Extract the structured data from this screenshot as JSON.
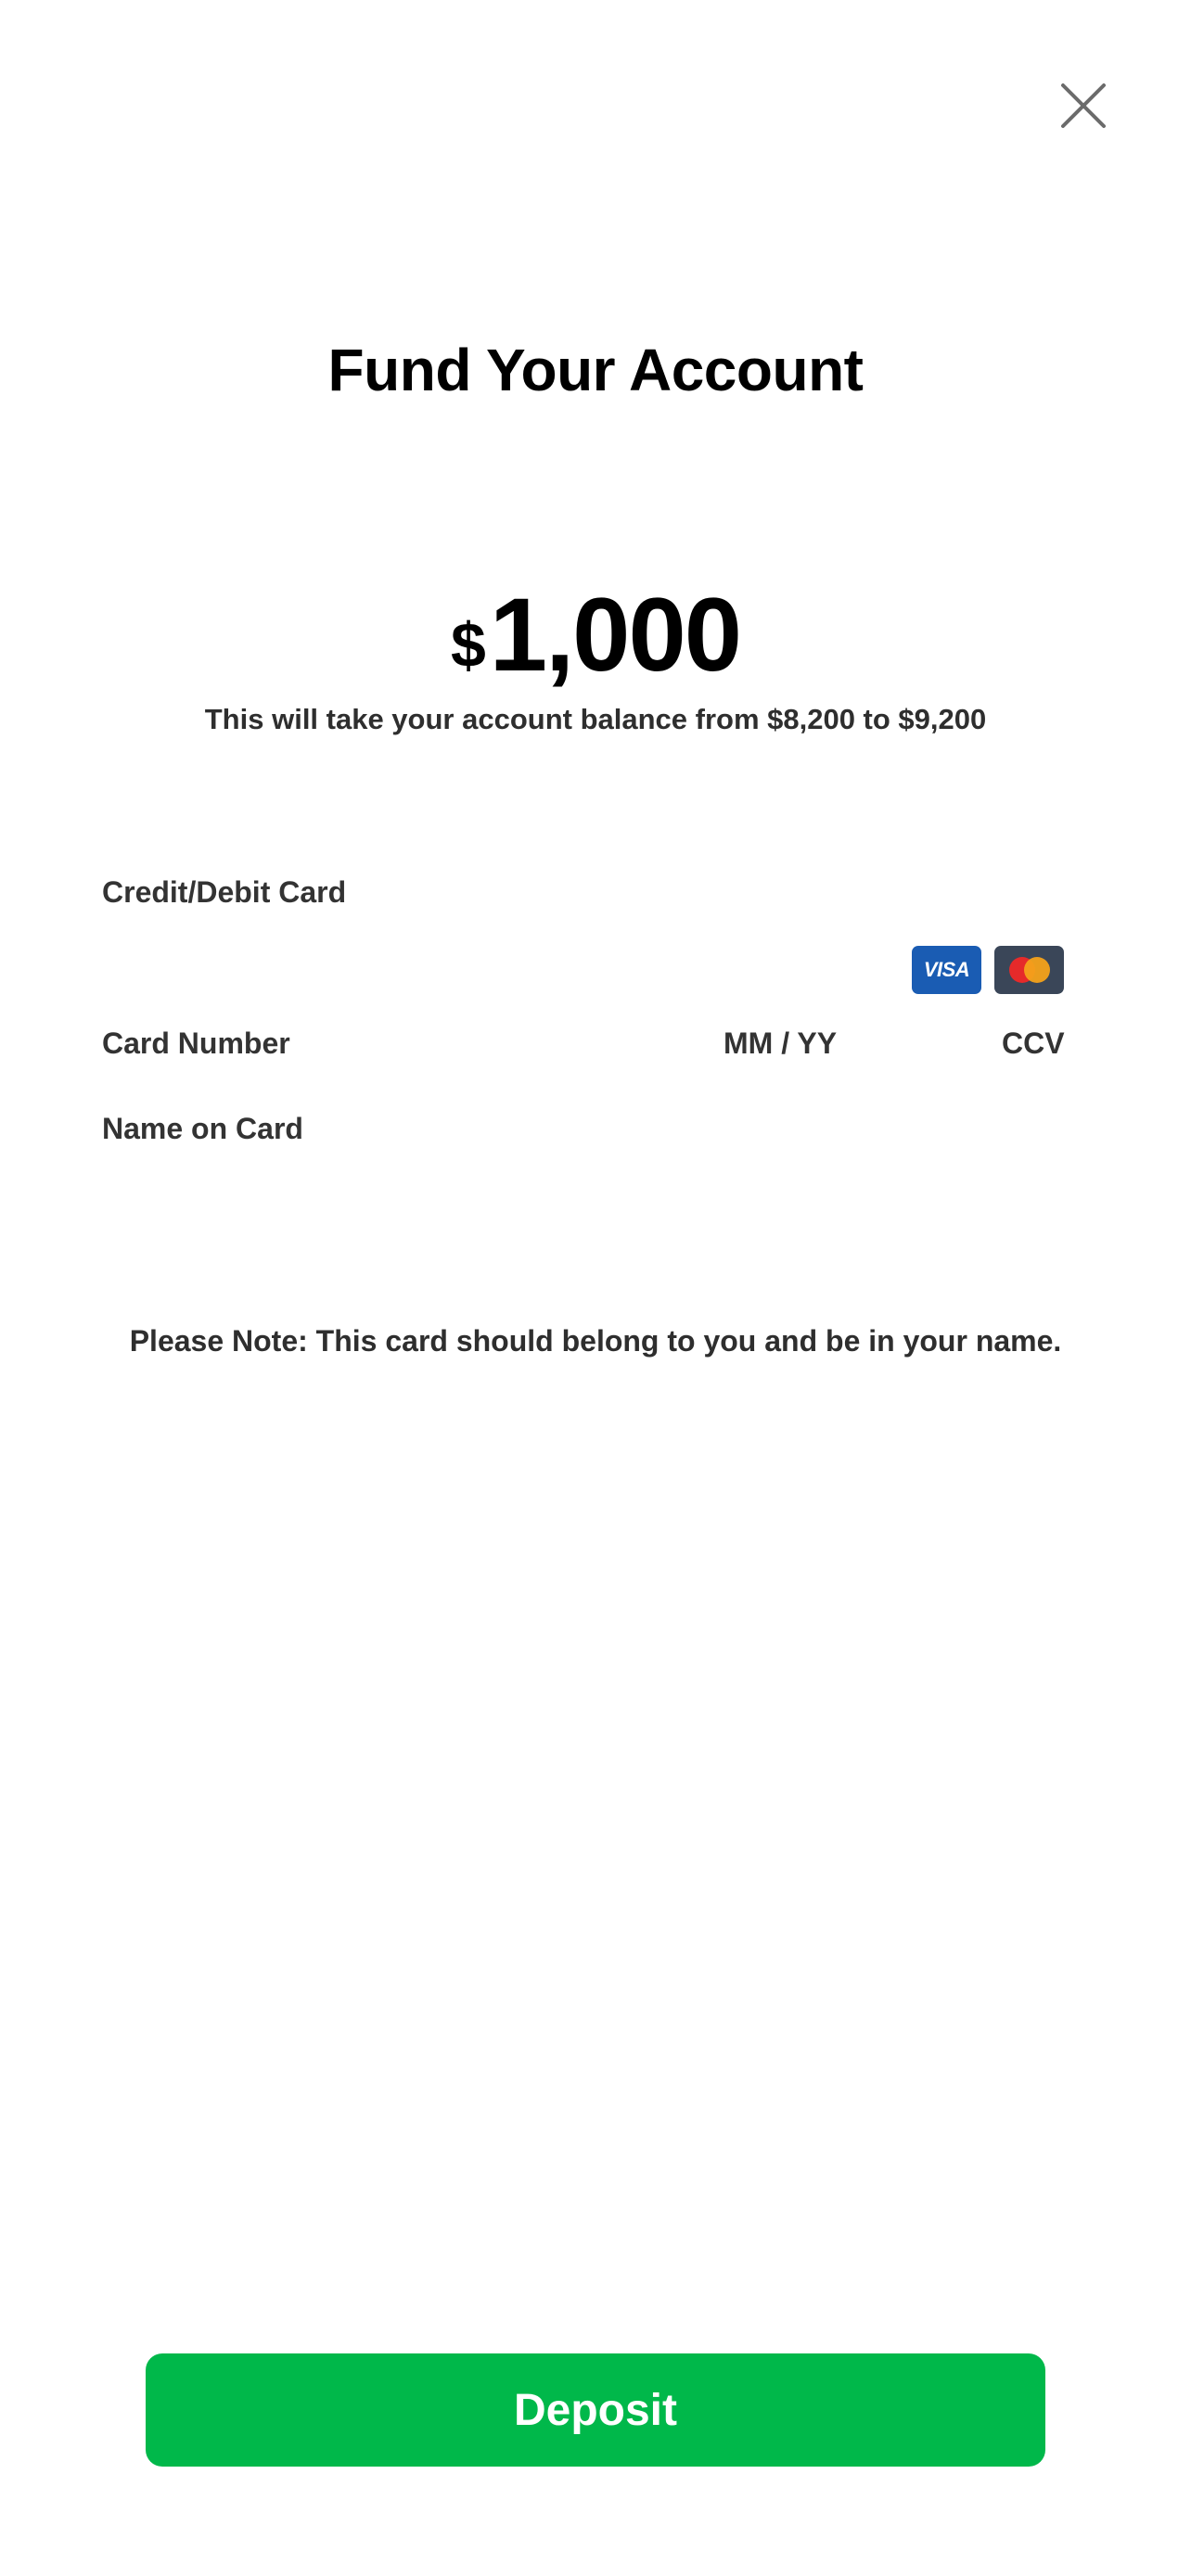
{
  "header": {
    "close_icon": "close-icon"
  },
  "title": "Fund Your Account",
  "amount": {
    "currency": "$",
    "value": "1,000"
  },
  "balance_note": "This will take your account balance from $8,200 to $9,200",
  "payment_section": {
    "label": "Credit/Debit Card",
    "accepted_cards": [
      {
        "name": "VISA",
        "icon": "visa-logo-icon",
        "color": "#1a5cb3"
      },
      {
        "name": "Mastercard",
        "icon": "mastercard-logo-icon",
        "color": "#3a4658"
      }
    ],
    "fields": {
      "card_number": "Card Number",
      "expiry": "MM / YY",
      "ccv": "CCV",
      "name_on_card": "Name on Card"
    }
  },
  "please_note": "Please Note: This card should belong to you and be in your name.",
  "footer": {
    "deposit_label": "Deposit",
    "deposit_color": "#00b84a"
  }
}
